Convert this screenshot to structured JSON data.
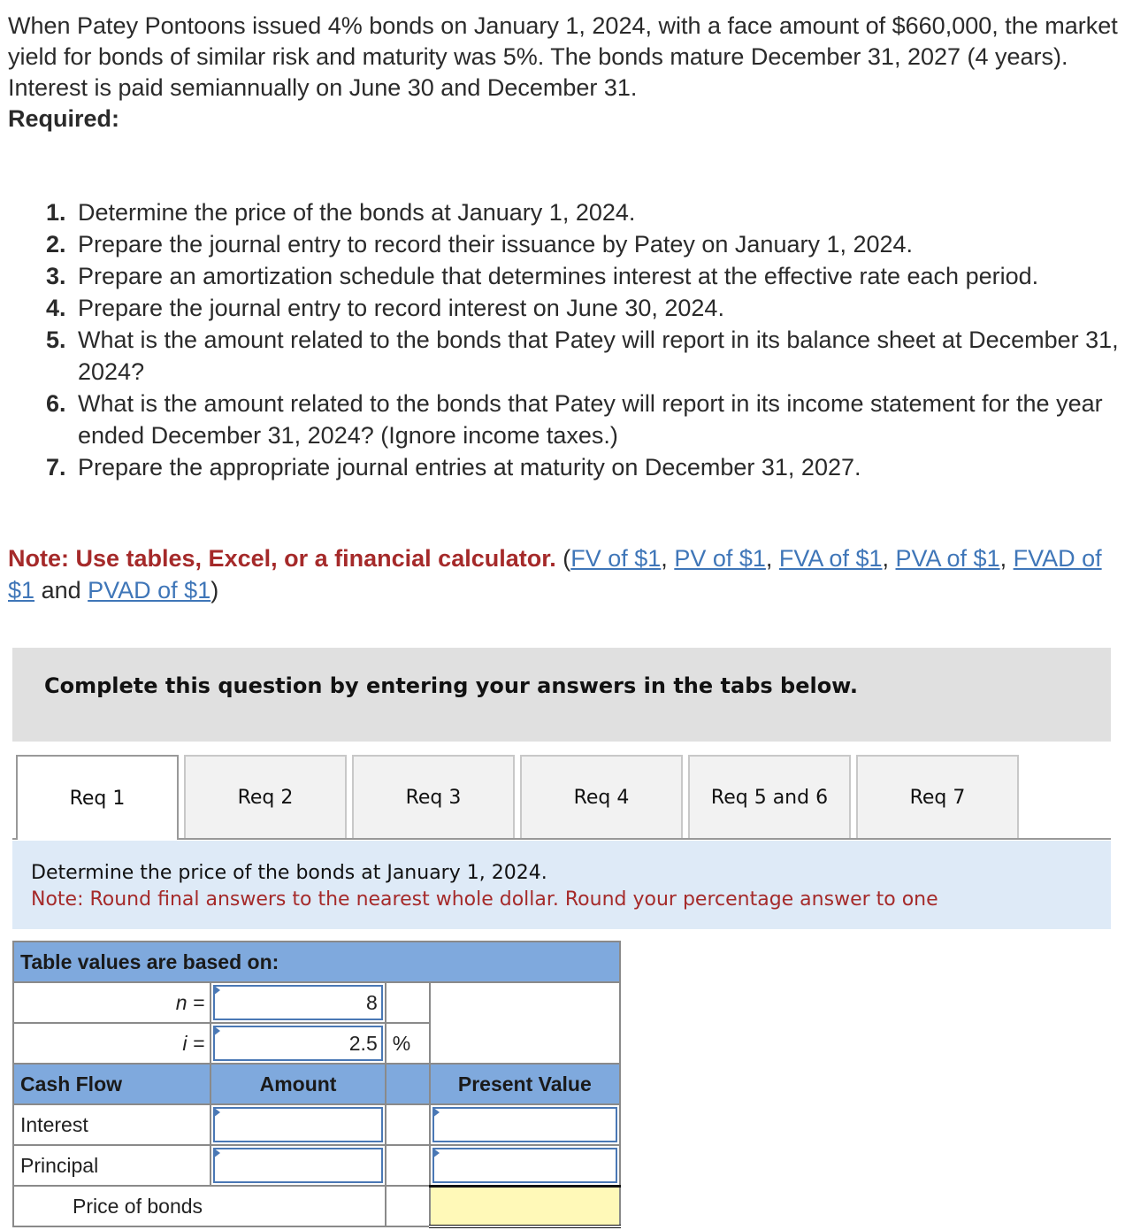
{
  "problem": {
    "intro": "When Patey Pontoons issued 4% bonds on January 1, 2024, with a face amount of $660,000, the market yield for bonds of similar risk and maturity was 5%. The bonds mature December 31, 2027 (4 years). Interest is paid semiannually on June 30 and December 31.",
    "required_label": "Required:",
    "requirements": [
      {
        "num": "1.",
        "text": "Determine the price of the bonds at January 1, 2024."
      },
      {
        "num": "2.",
        "text": "Prepare the journal entry to record their issuance by Patey on January 1, 2024."
      },
      {
        "num": "3.",
        "text": "Prepare an amortization schedule that determines interest at the effective rate each period."
      },
      {
        "num": "4.",
        "text": "Prepare the journal entry to record interest on June 30, 2024."
      },
      {
        "num": "5.",
        "text": "What is the amount related to the bonds that Patey will report in its balance sheet at December 31, 2024?"
      },
      {
        "num": "6.",
        "text": "What is the amount related to the bonds that Patey will report in its income statement for the year ended December 31, 2024? (Ignore income taxes.)"
      },
      {
        "num": "7.",
        "text": "Prepare the appropriate journal entries at maturity on December 31, 2027."
      }
    ],
    "note_bold": "Note: Use tables, Excel, or a financial calculator.",
    "links": [
      "FV of $1",
      "PV of $1",
      "FVA of $1",
      "PVA of $1",
      "FVAD of $1",
      "PVAD of $1"
    ],
    "and_word": "and"
  },
  "banner": {
    "text": "Complete this question by entering your answers in the tabs below."
  },
  "tabs": [
    {
      "label": "Req 1",
      "active": true
    },
    {
      "label": "Req 2",
      "active": false
    },
    {
      "label": "Req 3",
      "active": false
    },
    {
      "label": "Req 4",
      "active": false
    },
    {
      "label": "Req 5 and 6",
      "active": false
    },
    {
      "label": "Req 7",
      "active": false
    }
  ],
  "instructions": {
    "line1": "Determine the price of the bonds at January 1, 2024.",
    "line2": "Note: Round final answers to the nearest whole dollar. Round your percentage answer to one"
  },
  "pv_table": {
    "caption": "Table values are based on:",
    "n_label": "n =",
    "n_value": "8",
    "i_label": "i =",
    "i_value": "2.5",
    "percent_sign": "%",
    "headers": {
      "cash_flow": "Cash Flow",
      "amount": "Amount",
      "present_value": "Present Value"
    },
    "rows": [
      {
        "label": "Interest",
        "amount": "",
        "present_value": ""
      },
      {
        "label": "Principal",
        "amount": "",
        "present_value": ""
      }
    ],
    "total_label": "Price of bonds",
    "total_value": ""
  }
}
